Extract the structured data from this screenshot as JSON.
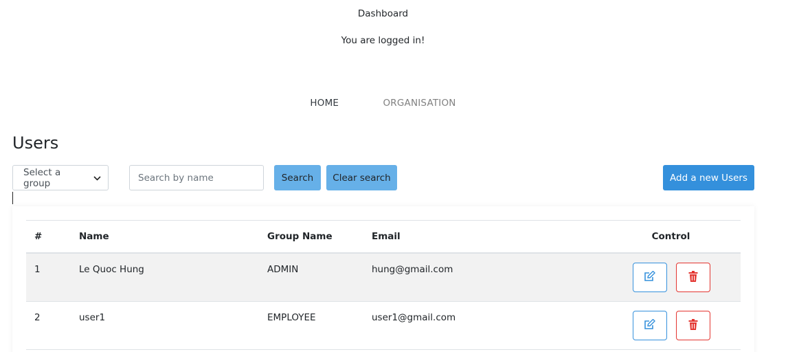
{
  "header": {
    "title": "Dashboard",
    "message": "You are logged in!"
  },
  "nav": {
    "items": [
      {
        "label": "HOME",
        "active": true
      },
      {
        "label": "ORGANISATION",
        "active": false
      }
    ]
  },
  "page_title": "Users",
  "filters": {
    "group_select": {
      "selected": "Select a group"
    },
    "search": {
      "placeholder": "Search by name",
      "value": ""
    },
    "search_label": "Search",
    "clear_label": "Clear search",
    "add_label": "Add a new Users"
  },
  "table": {
    "columns": [
      "#",
      "Name",
      "Group Name",
      "Email",
      "Control"
    ],
    "rows": [
      {
        "num": "1",
        "name": "Le Quoc Hung",
        "group": "ADMIN",
        "email": "hung@gmail.com"
      },
      {
        "num": "2",
        "name": "user1",
        "group": "EMPLOYEE",
        "email": "user1@gmail.com"
      }
    ]
  },
  "icons": {
    "edit": "edit-icon",
    "delete": "trash-icon",
    "select": "chevron-down-icon"
  },
  "colors": {
    "primary": "#3490dc",
    "light_primary": "#66b0e8",
    "danger": "#e3342f",
    "stripe": "#f2f2f2"
  }
}
